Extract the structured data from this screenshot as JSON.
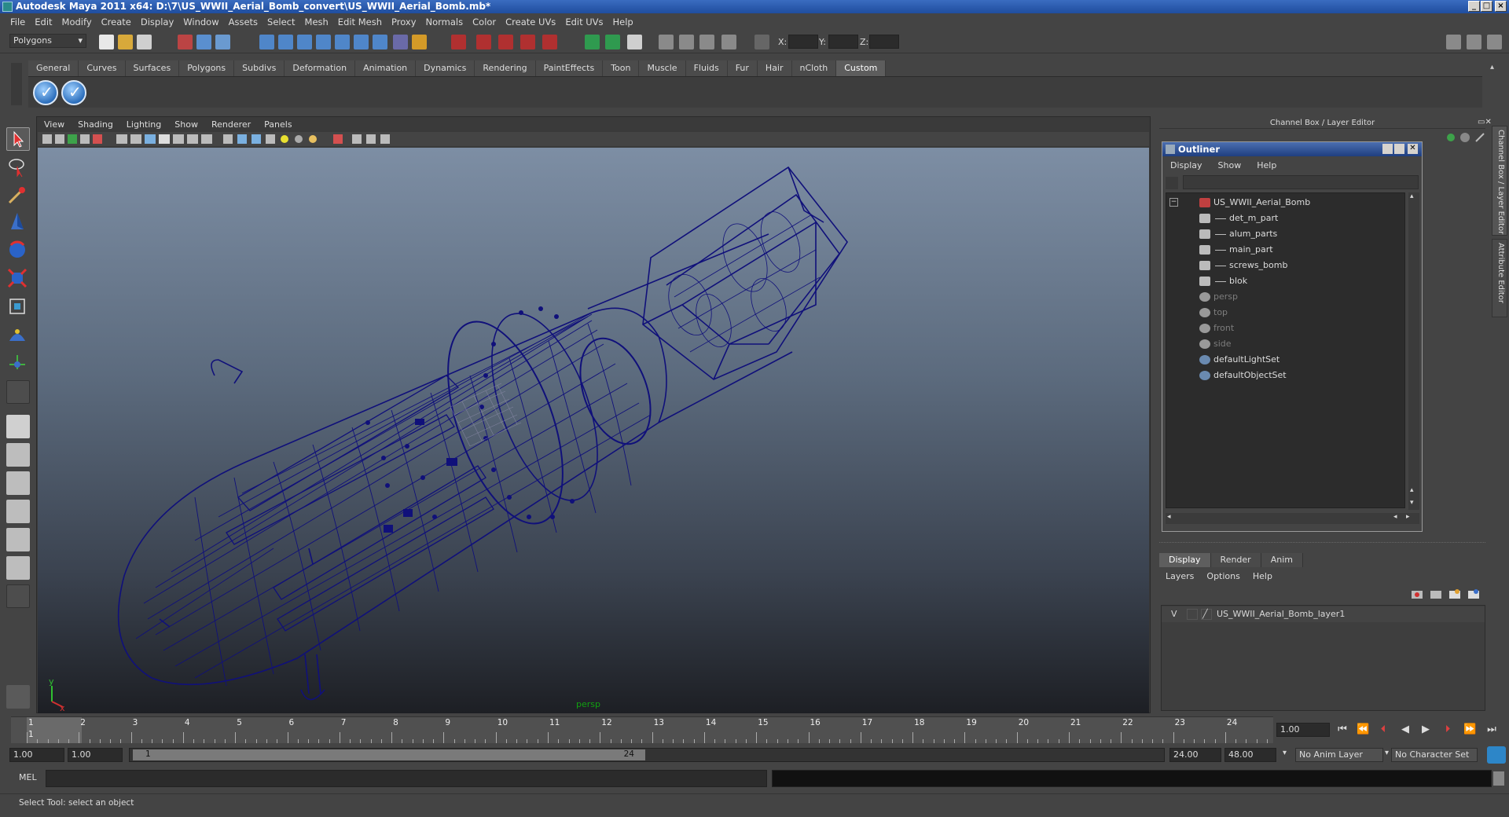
{
  "window": {
    "title": "Autodesk Maya 2011 x64: D:\\7\\US_WWII_Aerial_Bomb_convert\\US_WWII_Aerial_Bomb.mb*",
    "minimize": "_",
    "maximize": "□",
    "close": "×"
  },
  "menubar": [
    "File",
    "Edit",
    "Modify",
    "Create",
    "Display",
    "Window",
    "Assets",
    "Select",
    "Mesh",
    "Edit Mesh",
    "Proxy",
    "Normals",
    "Color",
    "Create UVs",
    "Edit UVs",
    "Help"
  ],
  "statusline": {
    "menuset": "Polygons",
    "x_label": "X:",
    "y_label": "Y:",
    "z_label": "Z:"
  },
  "shelf": {
    "tabs": [
      "General",
      "Curves",
      "Surfaces",
      "Polygons",
      "Subdivs",
      "Deformation",
      "Animation",
      "Dynamics",
      "Rendering",
      "PaintEffects",
      "Toon",
      "Muscle",
      "Fluids",
      "Fur",
      "Hair",
      "nCloth",
      "Custom"
    ],
    "active_tab": "Custom"
  },
  "viewport": {
    "menu": [
      "View",
      "Shading",
      "Lighting",
      "Show",
      "Renderer",
      "Panels"
    ],
    "camera": "persp",
    "axis_y": "y",
    "axis_x": "x"
  },
  "channel_box": {
    "title": "Channel Box / Layer Editor"
  },
  "side_tabs": {
    "channel": "Channel Box / Layer Editor",
    "attribute": "Attribute Editor"
  },
  "outliner": {
    "title": "Outliner",
    "menu": [
      "Display",
      "Show",
      "Help"
    ],
    "items": [
      {
        "label": "US_WWII_Aerial_Bomb",
        "depth": 0,
        "dim": false,
        "kind": "group"
      },
      {
        "label": "det_m_part",
        "depth": 1,
        "dim": false,
        "kind": "mesh"
      },
      {
        "label": "alum_parts",
        "depth": 1,
        "dim": false,
        "kind": "mesh"
      },
      {
        "label": "main_part",
        "depth": 1,
        "dim": false,
        "kind": "mesh"
      },
      {
        "label": "screws_bomb",
        "depth": 1,
        "dim": false,
        "kind": "mesh"
      },
      {
        "label": "blok",
        "depth": 1,
        "dim": false,
        "kind": "mesh"
      },
      {
        "label": "persp",
        "depth": 0,
        "dim": true,
        "kind": "camera"
      },
      {
        "label": "top",
        "depth": 0,
        "dim": true,
        "kind": "camera"
      },
      {
        "label": "front",
        "depth": 0,
        "dim": true,
        "kind": "camera"
      },
      {
        "label": "side",
        "depth": 0,
        "dim": true,
        "kind": "camera"
      },
      {
        "label": "defaultLightSet",
        "depth": 0,
        "dim": false,
        "kind": "set"
      },
      {
        "label": "defaultObjectSet",
        "depth": 0,
        "dim": false,
        "kind": "set"
      }
    ]
  },
  "layer_editor": {
    "tabs": [
      "Display",
      "Render",
      "Anim"
    ],
    "active_tab": "Display",
    "menu": [
      "Layers",
      "Options",
      "Help"
    ],
    "layers": [
      {
        "visible": "V",
        "name": "US_WWII_Aerial_Bomb_layer1"
      }
    ]
  },
  "timeline": {
    "start_marker": "1",
    "ticks": [
      "1",
      "2",
      "3",
      "4",
      "5",
      "6",
      "7",
      "8",
      "9",
      "10",
      "11",
      "12",
      "13",
      "14",
      "15",
      "16",
      "17",
      "18",
      "19",
      "20",
      "21",
      "22",
      "23",
      "24"
    ],
    "current_frame": "1.00"
  },
  "range": {
    "start_time": "1.00",
    "playback_start": "1.00",
    "slider_start": "1",
    "slider_end": "24",
    "playback_end": "24.00",
    "end_time": "48.00",
    "anim_layer": "No Anim Layer",
    "character_set": "No Character Set"
  },
  "command_line": {
    "label": "MEL"
  },
  "help_line": {
    "text": "Select Tool: select an object"
  },
  "colors": {
    "wireframe": "#10107a",
    "title_blue": "#1f4d9e",
    "persp_label": "#11a011"
  }
}
